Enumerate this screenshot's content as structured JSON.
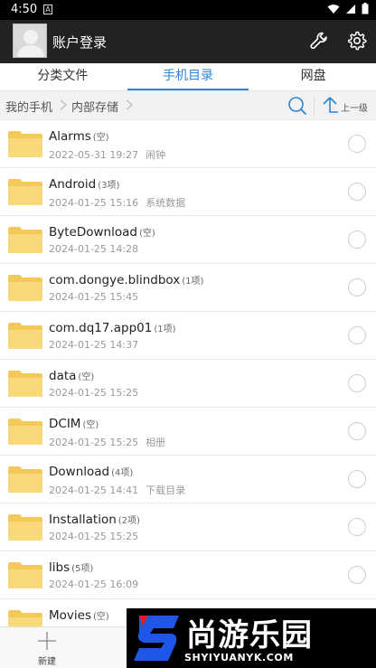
{
  "statusbar": {
    "time": "4:50",
    "sim_icon": "A"
  },
  "header": {
    "title": "账户登录",
    "icons": [
      "wrench-icon",
      "gear-icon"
    ]
  },
  "tabs": [
    {
      "label": "分类文件",
      "active": false
    },
    {
      "label": "手机目录",
      "active": true
    },
    {
      "label": "网盘",
      "active": false
    }
  ],
  "breadcrumb": {
    "items": [
      "我的手机",
      "内部存储"
    ],
    "up_label": "上一级"
  },
  "files": [
    {
      "name": "Alarms",
      "count": "(空)",
      "date": "2022-05-31 19:27",
      "note": "闹钟"
    },
    {
      "name": "Android",
      "count": "(3项)",
      "date": "2024-01-25 15:16",
      "note": "系统数据"
    },
    {
      "name": "ByteDownload",
      "count": "(空)",
      "date": "2024-01-25 14:28",
      "note": ""
    },
    {
      "name": "com.dongye.blindbox",
      "count": "(1项)",
      "date": "2024-01-25 15:45",
      "note": ""
    },
    {
      "name": "com.dq17.app01",
      "count": "(1项)",
      "date": "2024-01-25 14:37",
      "note": ""
    },
    {
      "name": "data",
      "count": "(空)",
      "date": "2024-01-25 15:25",
      "note": ""
    },
    {
      "name": "DCIM",
      "count": "(空)",
      "date": "2024-01-25 15:25",
      "note": "相册"
    },
    {
      "name": "Download",
      "count": "(4项)",
      "date": "2024-01-25 14:41",
      "note": "下载目录"
    },
    {
      "name": "Installation",
      "count": "(2项)",
      "date": "2024-01-25 15:25",
      "note": ""
    },
    {
      "name": "libs",
      "count": "(5项)",
      "date": "2024-01-25 16:09",
      "note": ""
    },
    {
      "name": "Movies",
      "count": "(空)",
      "date": "",
      "note": ""
    }
  ],
  "bottom": {
    "new_label": "新建"
  },
  "watermark": {
    "text": "尚游乐园",
    "url": "SHYIYUANYK.COM"
  },
  "colors": {
    "accent": "#2b86d8",
    "header_bg": "#222222",
    "folder": "#f8d775"
  }
}
